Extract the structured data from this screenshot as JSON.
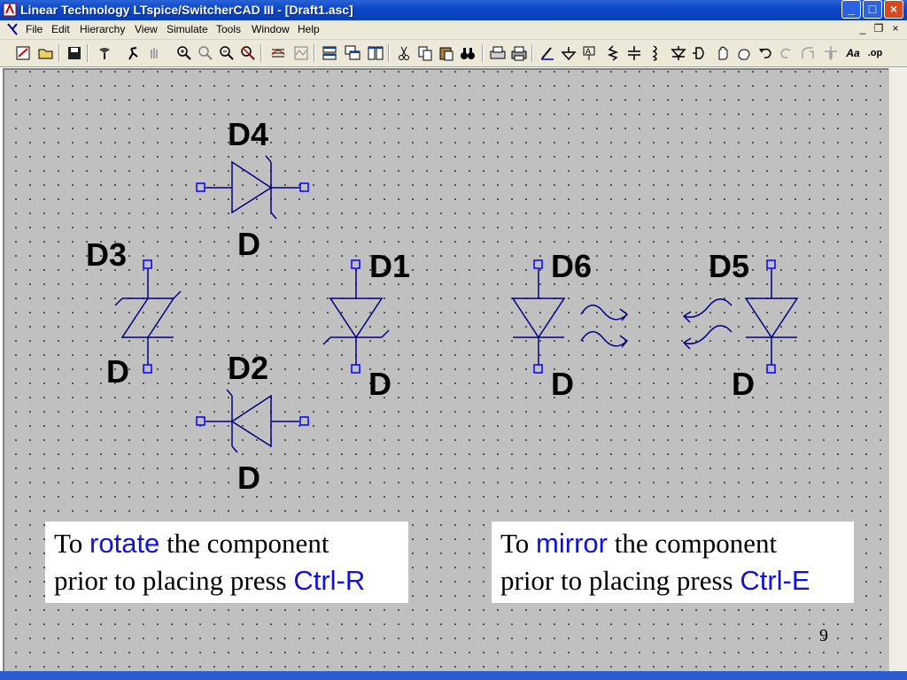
{
  "window": {
    "title": "Linear Technology LTspice/SwitcherCAD III - [Draft1.asc]",
    "controls": {
      "minimize": "_",
      "maximize": "□",
      "close": "×"
    }
  },
  "menu": {
    "items": [
      "File",
      "Edit",
      "Hierarchy",
      "View",
      "Simulate",
      "Tools",
      "Window",
      "Help"
    ],
    "mdi_controls": {
      "minimize": "_",
      "restore": "❐",
      "close": "×"
    }
  },
  "toolbar": {
    "icons": [
      "new-schematic-icon",
      "open-icon",
      "save-icon",
      "control-panel-icon",
      "run-icon",
      "halt-icon",
      "zoom-in-icon",
      "pan-icon",
      "zoom-out-icon",
      "zoom-fit-icon",
      "autorange-icon",
      "waveform-icon",
      "tile-horizontal-icon",
      "cascade-icon",
      "tile-vertical-icon",
      "cut-icon",
      "copy-icon",
      "paste-icon",
      "find-icon",
      "print-setup-icon",
      "print-icon",
      "wire-icon",
      "ground-icon",
      "label-net-icon",
      "resistor-icon",
      "capacitor-icon",
      "inductor-icon",
      "diode-icon",
      "component-icon",
      "move-icon",
      "drag-icon",
      "undo-icon",
      "redo-icon",
      "rotate-icon",
      "mirror-icon",
      "text-icon",
      "spice-directive-icon"
    ],
    "text_label": "Aa",
    "spice_label": ".op"
  },
  "schematic": {
    "diodes": [
      {
        "ref": "D4",
        "value": "D"
      },
      {
        "ref": "D3",
        "value": "D"
      },
      {
        "ref": "D1",
        "value": "D"
      },
      {
        "ref": "D2",
        "value": "D"
      },
      {
        "ref": "D6",
        "value": "D"
      },
      {
        "ref": "D5",
        "value": "D"
      }
    ],
    "colors": {
      "wire": "#000080",
      "pin": "#0000ff",
      "background": "#c0c0c0",
      "accent_text": "#1010e0"
    }
  },
  "notes": {
    "rotate": {
      "prefix": "To ",
      "keyword": "rotate",
      "middle": " the component",
      "line2": "prior to placing press ",
      "shortcut": "Ctrl-R"
    },
    "mirror": {
      "prefix": "To ",
      "keyword": "mirror",
      "middle": " the component",
      "line2": "prior to placing press ",
      "shortcut": "Ctrl-E"
    }
  },
  "slide_number": "9"
}
